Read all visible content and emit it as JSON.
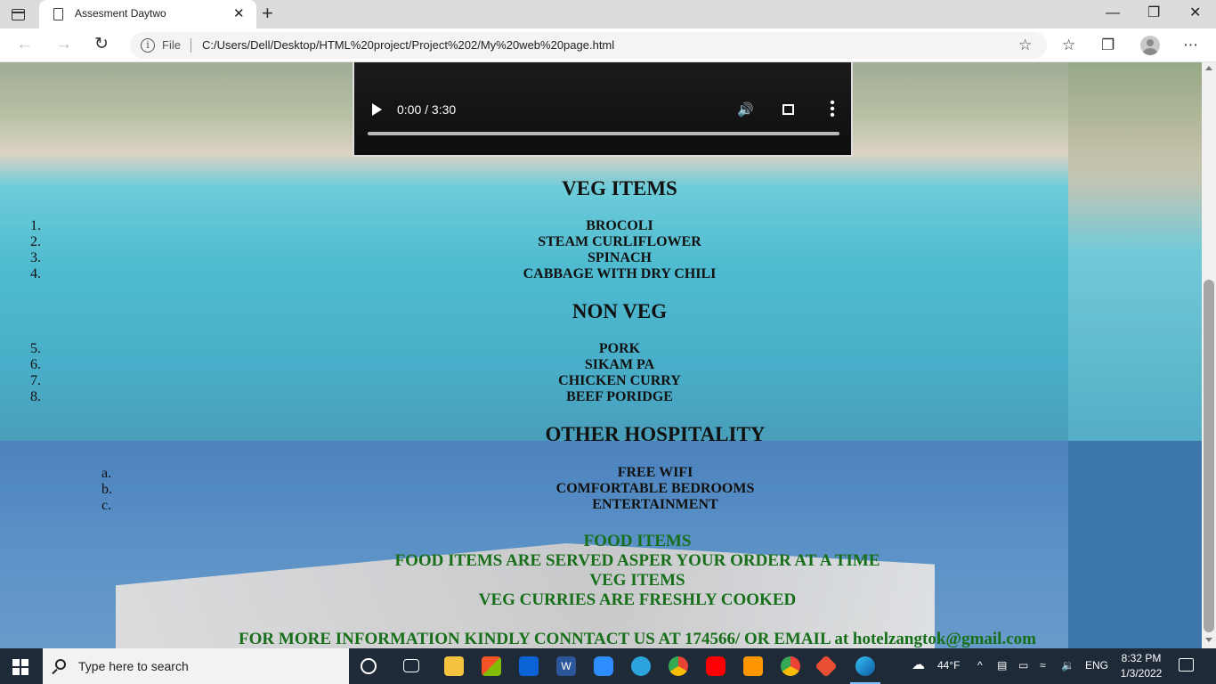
{
  "browser": {
    "tab_title": "Assesment Daytwo",
    "new_tab_label": "+",
    "close_tab_label": "✕",
    "file_label": "File",
    "url": "C:/Users/Dell/Desktop/HTML%20project/Project%202/My%20web%20page.html",
    "window_minimize": "—",
    "window_restore": "❐",
    "window_close": "✕",
    "icons": [
      "tab-actions-icon",
      "page-icon",
      "back-icon",
      "forward-icon",
      "refresh-icon",
      "info-icon",
      "add-favorite-icon",
      "favorites-icon",
      "collections-icon",
      "profile-avatar",
      "more-icon"
    ]
  },
  "video": {
    "time": "0:00 / 3:30",
    "progress": 0
  },
  "veg": {
    "heading": "VEG ITEMS",
    "items": [
      {
        "marker": "1.",
        "label": "BROCOLI"
      },
      {
        "marker": "2.",
        "label": "STEAM CURLIFLOWER"
      },
      {
        "marker": "3.",
        "label": "SPINACH"
      },
      {
        "marker": "4.",
        "label": "CABBAGE WITH DRY CHILI"
      }
    ]
  },
  "nonveg": {
    "heading": "NON VEG",
    "items": [
      {
        "marker": "5.",
        "label": "PORK"
      },
      {
        "marker": "6.",
        "label": "SIKAM PA"
      },
      {
        "marker": "7.",
        "label": "CHICKEN CURRY"
      },
      {
        "marker": "8.",
        "label": "BEEF PORIDGE"
      }
    ]
  },
  "hospitality": {
    "heading": "OTHER HOSPITALITY",
    "items": [
      {
        "marker": "a.",
        "label": "FREE WIFI"
      },
      {
        "marker": "b.",
        "label": "COMFORTABLE BEDROOMS"
      },
      {
        "marker": "c.",
        "label": "ENTERTAINMENT"
      }
    ]
  },
  "info": {
    "line1": "FOOD ITEMS",
    "line2": "FOOD ITEMS ARE SERVED ASPER YOUR ORDER AT A TIME",
    "line3": "VEG ITEMS",
    "line4": "VEG CURRIES ARE FRESHLY COOKED",
    "contact": "FOR MORE INFORMATION KINDLY CONNTACT US AT 174566/ OR EMAIL at hotelzangtok@gmail.com"
  },
  "colors": {
    "info_green": "#176f1a",
    "taskbar": "#1f2a38"
  },
  "taskbar": {
    "search_placeholder": "Type here to search",
    "weather": "44°F",
    "language": "ENG",
    "time": "8:32 PM",
    "date": "1/3/2022",
    "apps": [
      "task-view-icon",
      "file-explorer-icon",
      "microsoft-store-icon",
      "mail-icon",
      "word-icon",
      "zoom-icon",
      "telegram-icon",
      "chrome-icon",
      "youtube-icon",
      "sublime-text-icon",
      "chrome-profile-icon",
      "git-icon",
      "edge-icon"
    ]
  }
}
